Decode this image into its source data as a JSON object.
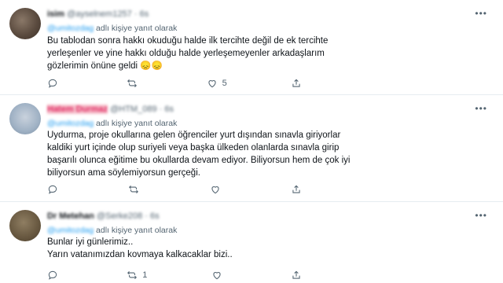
{
  "tweets": [
    {
      "name": "isim",
      "handle": "@ayselnem1257",
      "time": "6s",
      "reply_handle": "@umitozdag",
      "reply_suffix": "adlı kişiye yanıt olarak",
      "lines": [
        "Bu tablodan sonra hakkı okuduğu halde ilk tercihte değil de ek tercihte",
        "yerleşenler ve yine hakkı olduğu halde  yerleşemeyenler arkadaşlarım",
        "gözlerimin önüne geldi 😞😞"
      ],
      "counts": {
        "reply": "",
        "retweet": "",
        "like": "5",
        "share": ""
      }
    },
    {
      "name": "Hatem Durmaz",
      "handle": "@HTM_089",
      "time": "6s",
      "reply_handle": "@umitozdag",
      "reply_suffix": "adlı kişiye yanıt olarak",
      "lines": [
        "Uydurma, proje okullarına gelen öğrenciler yurt dışından sınavla giriyorlar",
        "kaldiki yurt içinde olup suriyeli veya başka ülkeden olanlarda sınavla girip",
        "başarılı olunca eğitime bu okullarda devam ediyor. Biliyorsun hem de çok iyi",
        "biliyorsun ama söylemiyorsun gerçeği."
      ],
      "counts": {
        "reply": "",
        "retweet": "",
        "like": "",
        "share": ""
      }
    },
    {
      "name": "Dr Metehan",
      "handle": "@Serke208",
      "time": "6s",
      "reply_handle": "@umitozdag",
      "reply_suffix": "adlı kişiye yanıt olarak",
      "lines": [
        "Bunlar iyi günlerimiz..",
        "Yarın vatanımızdan kovmaya kalkacaklar bizi.."
      ],
      "counts": {
        "reply": "",
        "retweet": "1",
        "like": "",
        "share": ""
      }
    }
  ],
  "more_glyph": "•••",
  "icons": [
    "more-icon",
    "reply-icon",
    "retweet-icon",
    "like-icon",
    "share-icon"
  ]
}
